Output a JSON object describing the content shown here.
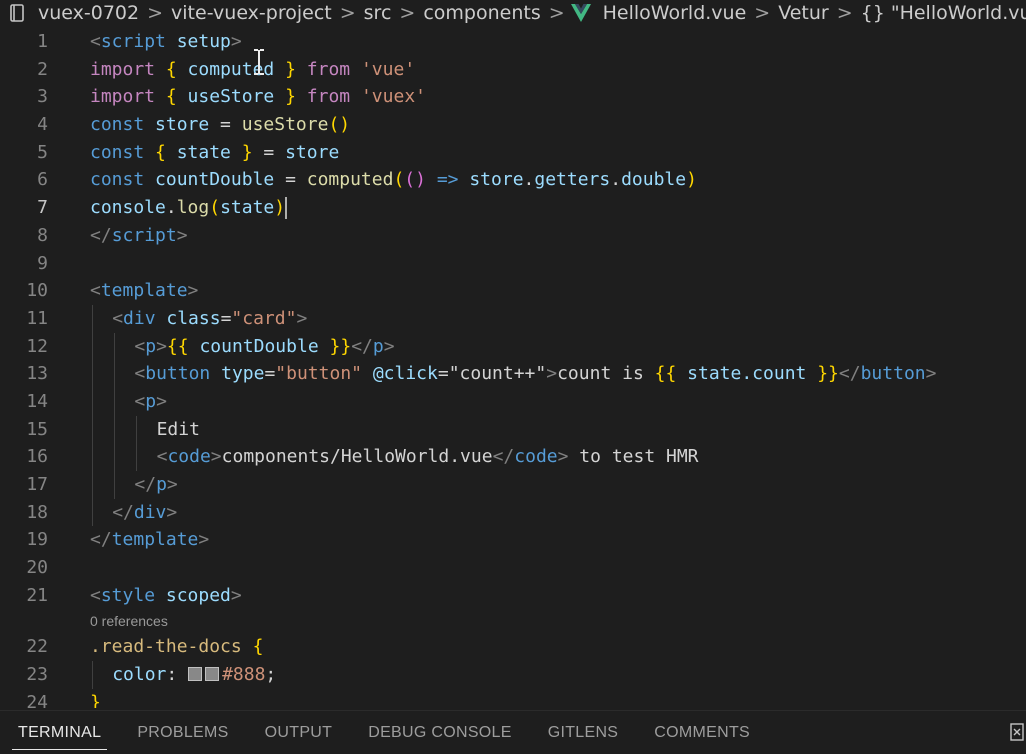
{
  "breadcrumb": {
    "items": [
      "vuex-0702",
      "vite-vuex-project",
      "src",
      "components",
      "HelloWorld.vue",
      "Vetur",
      "{} \"HelloWorld.vue\""
    ],
    "separator": ">"
  },
  "editor": {
    "lines": [
      {
        "n": "1",
        "segs": [
          [
            "tag",
            "<"
          ],
          [
            "tname",
            "script"
          ],
          [
            "attr",
            " setup"
          ],
          [
            "tag",
            ">"
          ]
        ]
      },
      {
        "n": "2",
        "segs": [
          [
            "kwc",
            "import"
          ],
          [
            "op",
            " "
          ],
          [
            "br1",
            "{"
          ],
          [
            "var",
            " computed "
          ],
          [
            "br1",
            "}"
          ],
          [
            "kwc",
            " from "
          ],
          [
            "str",
            "'vue'"
          ]
        ]
      },
      {
        "n": "3",
        "segs": [
          [
            "kwc",
            "import"
          ],
          [
            "op",
            " "
          ],
          [
            "br1",
            "{"
          ],
          [
            "var",
            " useStore "
          ],
          [
            "br1",
            "}"
          ],
          [
            "kwc",
            " from "
          ],
          [
            "str",
            "'vuex'"
          ]
        ]
      },
      {
        "n": "4",
        "segs": [
          [
            "kw",
            "const"
          ],
          [
            "var",
            " store"
          ],
          [
            "op",
            " = "
          ],
          [
            "fn",
            "useStore"
          ],
          [
            "br1",
            "()"
          ]
        ]
      },
      {
        "n": "5",
        "segs": [
          [
            "kw",
            "const"
          ],
          [
            "op",
            " "
          ],
          [
            "br1",
            "{"
          ],
          [
            "var",
            " state "
          ],
          [
            "br1",
            "}"
          ],
          [
            "op",
            " = "
          ],
          [
            "var",
            "store"
          ]
        ]
      },
      {
        "n": "6",
        "segs": [
          [
            "kw",
            "const"
          ],
          [
            "var",
            " countDouble"
          ],
          [
            "op",
            " = "
          ],
          [
            "fn",
            "computed"
          ],
          [
            "br1",
            "("
          ],
          [
            "br2",
            "()"
          ],
          [
            "kw",
            " => "
          ],
          [
            "var",
            "store"
          ],
          [
            "op",
            "."
          ],
          [
            "var",
            "getters"
          ],
          [
            "op",
            "."
          ],
          [
            "var",
            "double"
          ],
          [
            "br1",
            ")"
          ]
        ]
      },
      {
        "n": "7",
        "active": true,
        "segs": [
          [
            "var",
            "console"
          ],
          [
            "op",
            "."
          ],
          [
            "fn",
            "log"
          ],
          [
            "br1",
            "("
          ],
          [
            "var",
            "state"
          ],
          [
            "br1",
            ")"
          ]
        ]
      },
      {
        "n": "8",
        "segs": [
          [
            "tag",
            "</"
          ],
          [
            "tname",
            "script"
          ],
          [
            "tag",
            ">"
          ]
        ]
      },
      {
        "n": "9",
        "segs": []
      },
      {
        "n": "10",
        "segs": [
          [
            "tag",
            "<"
          ],
          [
            "tname",
            "template"
          ],
          [
            "tag",
            ">"
          ]
        ]
      },
      {
        "n": "11",
        "indent": 1,
        "segs": [
          [
            "tag",
            "<"
          ],
          [
            "tname",
            "div"
          ],
          [
            "attr",
            " class"
          ],
          [
            "op",
            "="
          ],
          [
            "str",
            "\"card\""
          ],
          [
            "tag",
            ">"
          ]
        ]
      },
      {
        "n": "12",
        "indent": 2,
        "segs": [
          [
            "tag",
            "<"
          ],
          [
            "tname",
            "p"
          ],
          [
            "tag",
            ">"
          ],
          [
            "br1",
            "{{"
          ],
          [
            "var",
            " countDouble "
          ],
          [
            "br1",
            "}}"
          ],
          [
            "tag",
            "</"
          ],
          [
            "tname",
            "p"
          ],
          [
            "tag",
            ">"
          ]
        ]
      },
      {
        "n": "13",
        "indent": 2,
        "segs": [
          [
            "tag",
            "<"
          ],
          [
            "tname",
            "button"
          ],
          [
            "attr",
            " type"
          ],
          [
            "op",
            "="
          ],
          [
            "str",
            "\"button\""
          ],
          [
            "attr",
            " @click"
          ],
          [
            "op",
            "="
          ],
          [
            "txt",
            "\"count++\""
          ],
          [
            "tag",
            ">"
          ],
          [
            "txt",
            "count is "
          ],
          [
            "br1",
            "{{"
          ],
          [
            "var",
            " state.count "
          ],
          [
            "br1",
            "}}"
          ],
          [
            "tag",
            "</"
          ],
          [
            "tname",
            "button"
          ],
          [
            "tag",
            ">"
          ]
        ]
      },
      {
        "n": "14",
        "indent": 2,
        "segs": [
          [
            "tag",
            "<"
          ],
          [
            "tname",
            "p"
          ],
          [
            "tag",
            ">"
          ]
        ]
      },
      {
        "n": "15",
        "indent": 3,
        "segs": [
          [
            "txt",
            "Edit"
          ]
        ]
      },
      {
        "n": "16",
        "indent": 3,
        "segs": [
          [
            "tag",
            "<"
          ],
          [
            "tname",
            "code"
          ],
          [
            "tag",
            ">"
          ],
          [
            "txt",
            "components/HelloWorld.vue"
          ],
          [
            "tag",
            "</"
          ],
          [
            "tname",
            "code"
          ],
          [
            "tag",
            ">"
          ],
          [
            "txt",
            " to test HMR"
          ]
        ]
      },
      {
        "n": "17",
        "indent": 2,
        "segs": [
          [
            "tag",
            "</"
          ],
          [
            "tname",
            "p"
          ],
          [
            "tag",
            ">"
          ]
        ]
      },
      {
        "n": "18",
        "indent": 1,
        "segs": [
          [
            "tag",
            "</"
          ],
          [
            "tname",
            "div"
          ],
          [
            "tag",
            ">"
          ]
        ]
      },
      {
        "n": "19",
        "segs": [
          [
            "tag",
            "</"
          ],
          [
            "tname",
            "template"
          ],
          [
            "tag",
            ">"
          ]
        ]
      },
      {
        "n": "20",
        "segs": []
      },
      {
        "n": "21",
        "segs": [
          [
            "tag",
            "<"
          ],
          [
            "tname",
            "style"
          ],
          [
            "attr",
            " scoped"
          ],
          [
            "tag",
            ">"
          ]
        ]
      },
      {
        "lens": "0 references"
      },
      {
        "n": "22",
        "segs": [
          [
            "sel",
            ".read-the-docs"
          ],
          [
            "op",
            " "
          ],
          [
            "br1",
            "{"
          ]
        ]
      },
      {
        "n": "23",
        "indent": 1,
        "segs": [
          [
            "attr",
            "color"
          ],
          [
            "op",
            ": "
          ],
          [
            "swatch",
            ""
          ],
          [
            "swatch",
            ""
          ],
          [
            "str",
            "#888"
          ],
          [
            "op",
            ";"
          ]
        ]
      },
      {
        "n": "24",
        "segs": [
          [
            "br1",
            "}"
          ]
        ]
      }
    ]
  },
  "panel": {
    "tabs": [
      "TERMINAL",
      "PROBLEMS",
      "OUTPUT",
      "DEBUG CONSOLE",
      "GITLENS",
      "COMMENTS"
    ],
    "active": "TERMINAL"
  },
  "colors": {
    "background": "#1e1e1e",
    "line_number": "#858585",
    "keyword": "#569cd6",
    "string": "#ce9178",
    "variable": "#9cdcfe",
    "function": "#dcdcaa",
    "bracket": "#ffd700",
    "vue_logo": "#42b883"
  },
  "icons": [
    "book-icon",
    "vue-logo-icon",
    "close-panel-icon",
    "text-cursor-icon"
  ]
}
